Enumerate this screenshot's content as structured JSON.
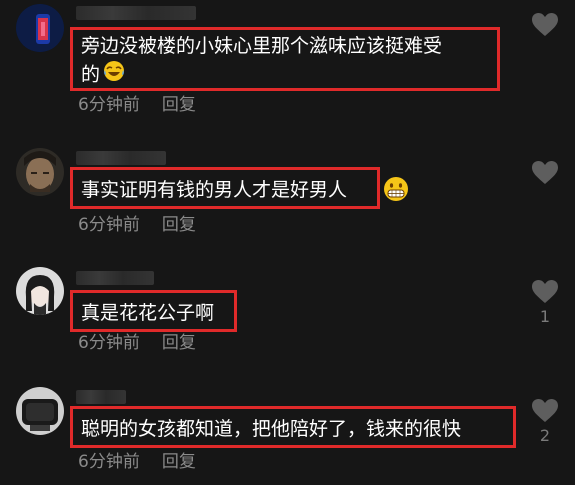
{
  "comments": [
    {
      "text_line1": "旁边没被楼的小妹心里那个滋味应该挺难受",
      "text_line2": "的",
      "time": "6分钟前",
      "reply": "回复",
      "likes": ""
    },
    {
      "text": "事实证明有钱的男人才是好男人",
      "time": "6分钟前",
      "reply": "回复",
      "likes": ""
    },
    {
      "text": "真是花花公子啊",
      "time": "6分钟前",
      "reply": "回复",
      "likes": "1"
    },
    {
      "text": "聪明的女孩都知道，把他陪好了，钱来的很快",
      "time": "6分钟前",
      "reply": "回复",
      "likes": "2"
    }
  ],
  "colors": {
    "background": "#161616",
    "highlight_border": "#e02a2a",
    "meta_text": "#8a8a8a",
    "heart_icon": "#5e5e5e"
  },
  "icons": {
    "like": "heart-icon",
    "emoji_1": "laughing-tears-emoji-icon",
    "emoji_2": "grinning-teeth-emoji-icon"
  }
}
